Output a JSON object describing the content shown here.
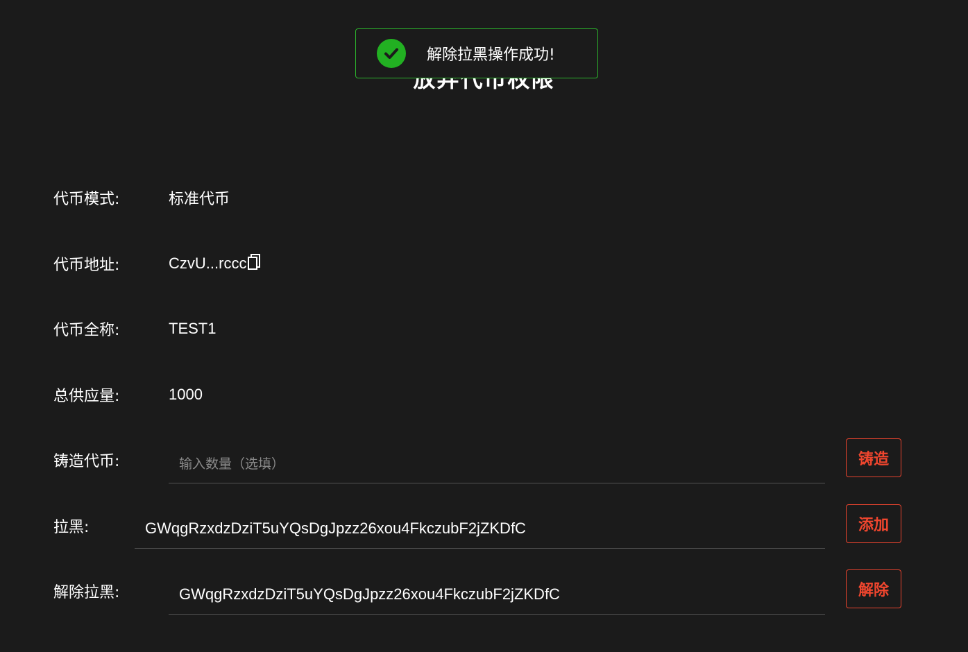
{
  "page": {
    "title": "放弃代币权限"
  },
  "toast": {
    "message": "解除拉黑操作成功!",
    "icon": "check-circle-icon",
    "status_color": "#22b022"
  },
  "token_info": {
    "mode_label": "代币模式:",
    "mode_value": "标准代币",
    "address_label": "代币地址:",
    "address_value": "CzvU...rccc",
    "address_icon": "copy-icon",
    "name_label": "代币全称:",
    "name_value": "TEST1",
    "supply_label": "总供应量:",
    "supply_value": "1000"
  },
  "mint": {
    "label": "铸造代币:",
    "placeholder": "输入数量（选填）",
    "value": "",
    "button_label": "铸造"
  },
  "blacklist": {
    "label": "拉黑:",
    "value": "GWqgRzxdzDziT5uYQsDgJpzz26xou4FkczubF2jZKDfC",
    "button_label": "添加"
  },
  "unblacklist": {
    "label": "解除拉黑:",
    "value": "GWqgRzxdzDziT5uYQsDgJpzz26xou4FkczubF2jZKDfC",
    "button_label": "解除"
  },
  "colors": {
    "background": "#1b1b1b",
    "accent": "#f0462e",
    "success": "#2cb52c"
  }
}
